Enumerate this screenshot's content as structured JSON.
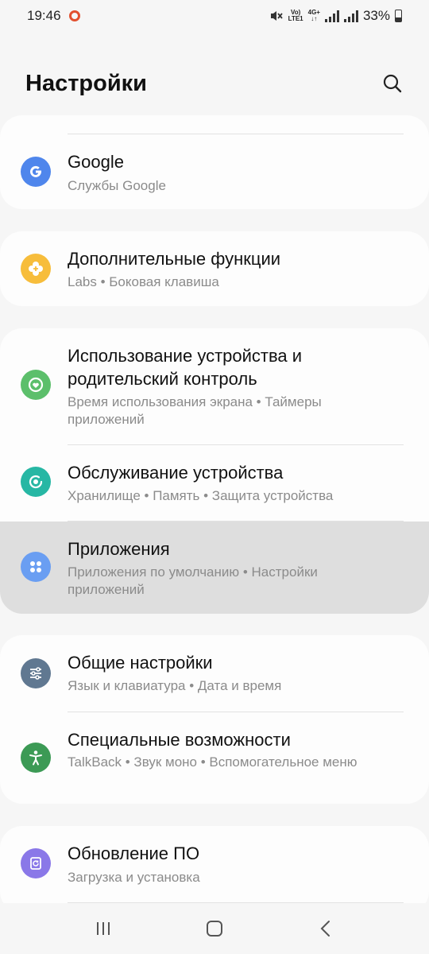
{
  "status_bar": {
    "time": "19:46",
    "volte_top": "Vo)",
    "volte_bottom": "LTE1",
    "network_top": "4G+",
    "network_bottom": "↓↑",
    "battery": "33%",
    "icons": [
      "record-indicator-icon",
      "mute-icon",
      "volte-icon",
      "network-icon",
      "signal-icon",
      "signal-icon",
      "battery-icon"
    ]
  },
  "header": {
    "title": "Настройки",
    "search_icon": "search-icon"
  },
  "items": [
    {
      "title": "Google",
      "subtitle": "Службы Google",
      "icon": "google-icon",
      "color": "#4f86ec"
    },
    {
      "title": "Дополнительные функции",
      "subtitle": "Labs • Боковая клавиша",
      "icon": "advanced-features-icon",
      "color": "#f7bd3b"
    },
    {
      "title": "Использование устройства и родительский контроль",
      "subtitle": "Время использования экрана • Таймеры приложений",
      "icon": "digital-wellbeing-icon",
      "color": "#5cbf6b"
    },
    {
      "title": "Обслуживание устройства",
      "subtitle": "Хранилище • Память • Защита устройства",
      "icon": "device-care-icon",
      "color": "#27b7a4"
    },
    {
      "title": "Приложения",
      "subtitle": "Приложения по умолчанию • Настройки приложений",
      "icon": "apps-icon",
      "color": "#6a9ef2"
    },
    {
      "title": "Общие настройки",
      "subtitle": "Язык и клавиатура • Дата и время",
      "icon": "general-settings-icon",
      "color": "#607891"
    },
    {
      "title": "Специальные возможности",
      "subtitle": "TalkBack • Звук моно • Вспомогательное меню",
      "icon": "accessibility-icon",
      "color": "#3c9a55"
    },
    {
      "title": "Обновление ПО",
      "subtitle": "Загрузка и установка",
      "icon": "software-update-icon",
      "color": "#8a78e8"
    }
  ],
  "navbar": {
    "icons": [
      "recent-apps-icon",
      "home-icon",
      "back-icon"
    ]
  }
}
